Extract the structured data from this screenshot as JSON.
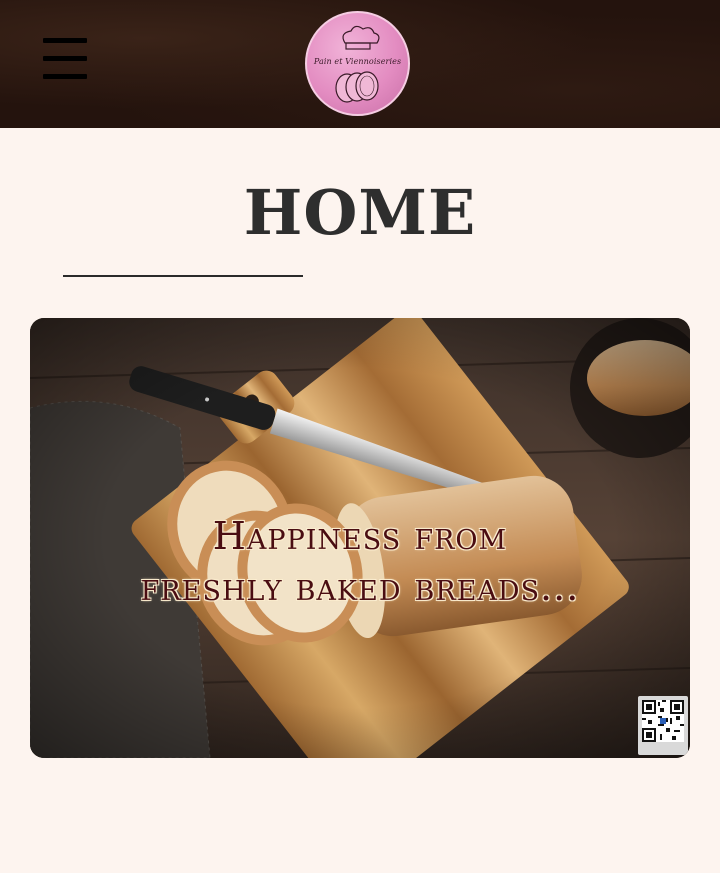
{
  "header": {
    "menu_icon": "hamburger-menu-icon",
    "logo_text": "Pain et Viennoiseries",
    "logo_icon": "chef-hat-bread-logo",
    "background": "#24130d",
    "logo_color": "#e38cc1"
  },
  "main": {
    "title": "HOME",
    "hero": {
      "line1": "Happiness from",
      "line2": "freshly baked breads...",
      "image": "bread on wooden cutting board with bread knife",
      "text_color": "#4a0d12"
    },
    "qr_badge": {
      "icon": "qr-code-icon"
    }
  },
  "colors": {
    "page_background": "#fdf4ef",
    "title": "#2e2e2e"
  }
}
